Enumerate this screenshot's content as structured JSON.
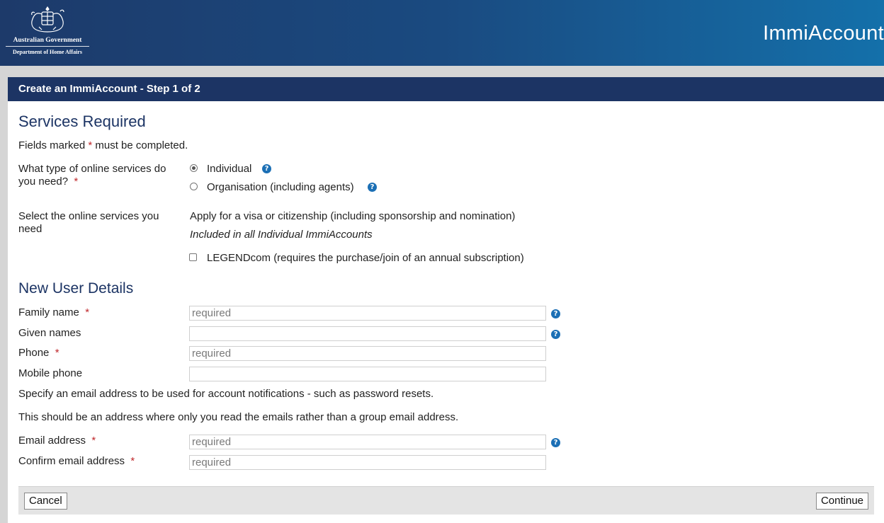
{
  "header": {
    "gov_line1": "Australian Government",
    "gov_line2": "Department of Home Affairs",
    "app_name": "ImmiAccount"
  },
  "panel": {
    "title": "Create an ImmiAccount - Step 1 of 2"
  },
  "services": {
    "heading": "Services Required",
    "fields_note_before": "Fields marked ",
    "fields_note_asterisk": "*",
    "fields_note_after": " must be completed.",
    "type_question": "What type of online services do you need?",
    "required_mark": "*",
    "options": [
      {
        "label": "Individual",
        "selected": true
      },
      {
        "label": "Organisation (including agents)",
        "selected": false
      }
    ],
    "select_label": "Select the online services you need",
    "apply_text": "Apply for a visa or citizenship (including sponsorship and nomination)",
    "included_text": "Included in all Individual ImmiAccounts",
    "legendcom_label": "LEGENDcom (requires the purchase/join of an annual subscription)",
    "legendcom_checked": false
  },
  "user": {
    "heading": "New User Details",
    "family_name_label": "Family name",
    "family_name_placeholder": "required",
    "given_names_label": "Given names",
    "phone_label": "Phone",
    "phone_placeholder": "required",
    "mobile_label": "Mobile phone",
    "email_note_1": "Specify an email address to be used for account notifications - such as password resets.",
    "email_note_2": "This should be an address where only you read the emails rather than a group email address.",
    "email_label": "Email address",
    "email_placeholder": "required",
    "confirm_email_label": "Confirm email address",
    "confirm_email_placeholder": "required"
  },
  "footer": {
    "cancel": "Cancel",
    "continue": "Continue"
  },
  "colors": {
    "header_dark": "#1c3464",
    "help_blue": "#1b6fb5",
    "required_red": "#c0282c"
  },
  "icons": {
    "crest": "coat-of-arms-icon",
    "help": "question-circle-icon"
  }
}
